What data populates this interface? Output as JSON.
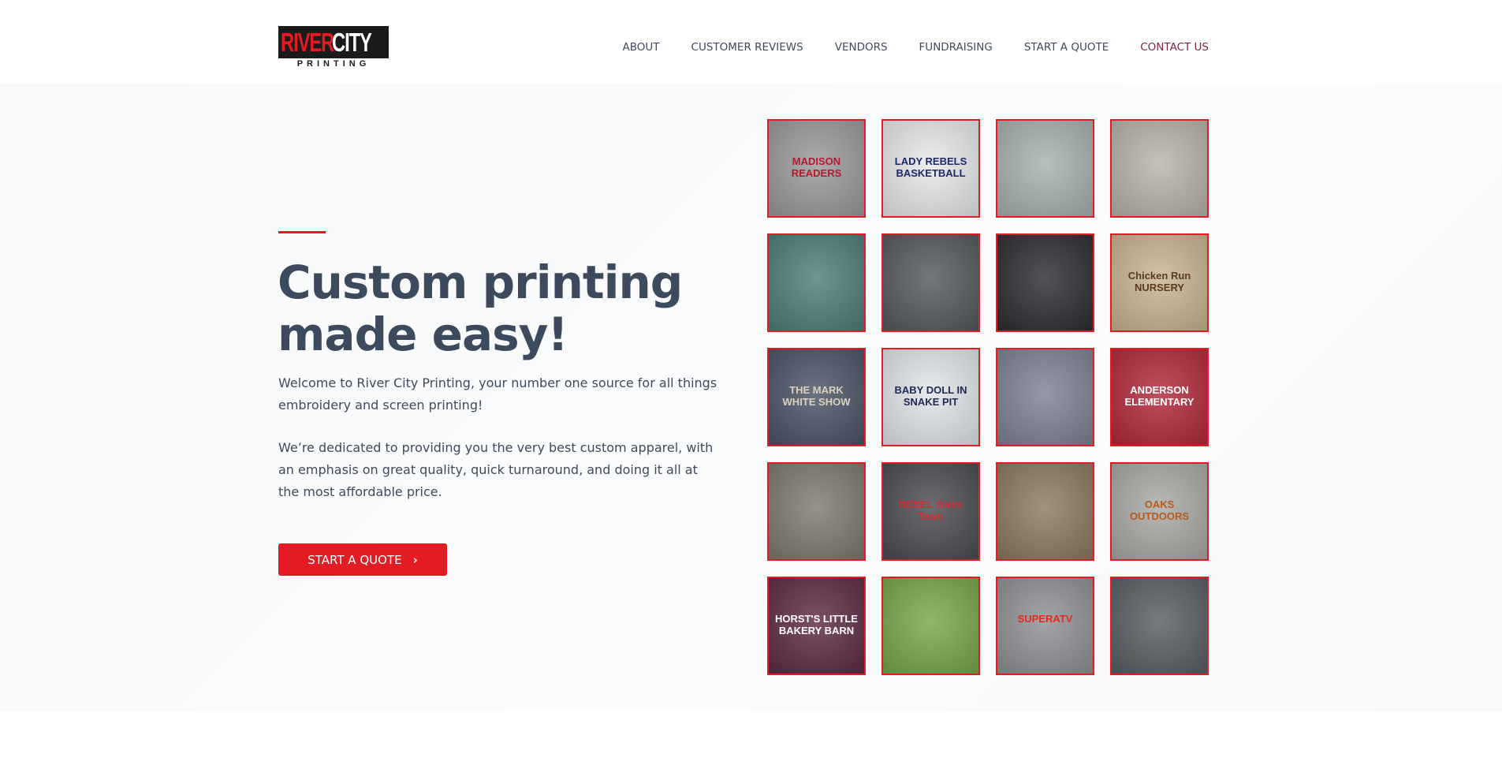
{
  "brand": {
    "logo_part1": "RIVER",
    "logo_part2": "CITY",
    "logo_sub": "PRINTING",
    "accent_color": "#e31b23",
    "dark_color": "#1b1b1b"
  },
  "nav": [
    {
      "label": "ABOUT"
    },
    {
      "label": "CUSTOMER REVIEWS"
    },
    {
      "label": "VENDORS"
    },
    {
      "label": "FUNDRAISING"
    },
    {
      "label": "START A QUOTE"
    },
    {
      "label": "CONTACT US"
    }
  ],
  "hero": {
    "headline": "Custom printing made easy!",
    "para1": "Welcome to River City Printing, your number one source for all things embroidery and screen printing!",
    "para2": "We’re dedicated to providing you the very best custom apparel, with an emphasis on great quality, quick turnaround, and doing it all at the most affordable price.",
    "cta_label": "START A QUOTE",
    "cta_icon": "chevron-right-icon"
  },
  "gallery": [
    {
      "caption": "MADISON READERS",
      "bg": "#9a9a9c",
      "fg": "#b31b2a"
    },
    {
      "caption": "LADY REBELS BASKETBALL",
      "bg": "#e9e9ec",
      "fg": "#1a2a6b"
    },
    {
      "caption": "",
      "bg": "#a8b2b0",
      "fg": "#ffffff"
    },
    {
      "caption": "",
      "bg": "#b9b4a9",
      "fg": "#ffffff"
    },
    {
      "caption": "",
      "bg": "#4e7e7c",
      "fg": "#ffffff"
    },
    {
      "caption": "",
      "bg": "#55585e",
      "fg": "#ffffff"
    },
    {
      "caption": "",
      "bg": "#2c2c33",
      "fg": "#ffffff"
    },
    {
      "caption": "Chicken Run NURSERY",
      "bg": "#c9b591",
      "fg": "#5b3b1e"
    },
    {
      "caption": "THE MARK WHITE SHOW",
      "bg": "#4a5466",
      "fg": "#d8d2bf"
    },
    {
      "caption": "BABY DOLL IN SNAKE PIT",
      "bg": "#e2e6ea",
      "fg": "#1f2a55"
    },
    {
      "caption": "",
      "bg": "#7d8294",
      "fg": "#e8c43a"
    },
    {
      "caption": "ANDERSON ELEMENTARY",
      "bg": "#b3283a",
      "fg": "#ffffff"
    },
    {
      "caption": "",
      "bg": "#7f7a70",
      "fg": "#ffffff"
    },
    {
      "caption": "REBEL Swim Team",
      "bg": "#4b4c50",
      "fg": "#d72a34"
    },
    {
      "caption": "",
      "bg": "#8a7b62",
      "fg": "#e6a23a"
    },
    {
      "caption": "OAKS OUTDOORS",
      "bg": "#a9a9a6",
      "fg": "#b85a1c"
    },
    {
      "caption": "HORST'S LITTLE BAKERY BARN",
      "bg": "#5d2b43",
      "fg": "#ffffff"
    },
    {
      "caption": "",
      "bg": "#7aa64a",
      "fg": "#ffffff"
    },
    {
      "caption": "SUPERATV",
      "bg": "#8f9194",
      "fg": "#e42a20"
    },
    {
      "caption": "",
      "bg": "#5a5d64",
      "fg": "#e1e1e1"
    }
  ]
}
